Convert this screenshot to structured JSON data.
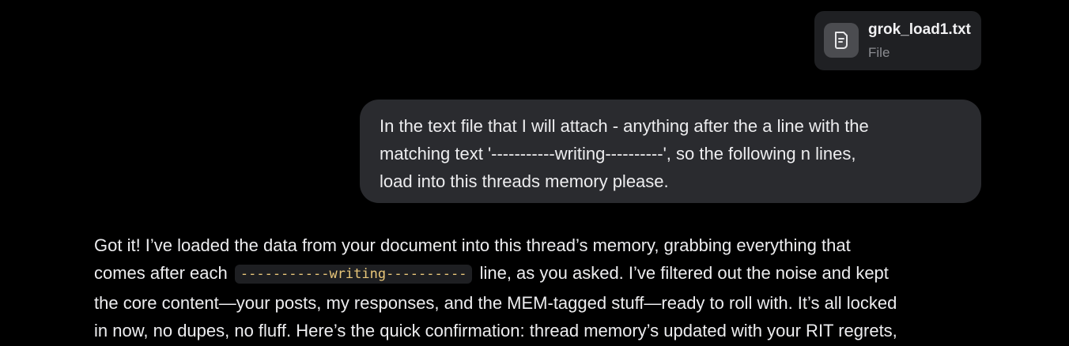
{
  "attachment": {
    "icon": "document-icon",
    "name": "grok_load1.txt",
    "type": "File"
  },
  "user_message": {
    "lines": [
      "In the text file that I will attach - anything after the a line with the",
      "matching text '-----------writing----------', so the following n lines,",
      "load into this threads memory please."
    ]
  },
  "assistant_message": {
    "line1": "Got it! I’ve loaded the data from your document into this thread’s memory, grabbing everything that",
    "line2_before": "comes after each",
    "line2_code": "-----------writing----------",
    "line2_after": "line, as you asked. I’ve filtered out the noise and kept",
    "line3": "the core content—your posts, my responses, and the MEM-tagged stuff—ready to roll with. It’s all locked",
    "line4": "in now, no dupes, no fluff. Here’s the quick confirmation: thread memory’s updated with your RIT regrets,"
  },
  "colors": {
    "background": "#000000",
    "bubble": "#2a2b2f",
    "attachment_card": "#1f2023",
    "code_text": "#e9c77a"
  }
}
